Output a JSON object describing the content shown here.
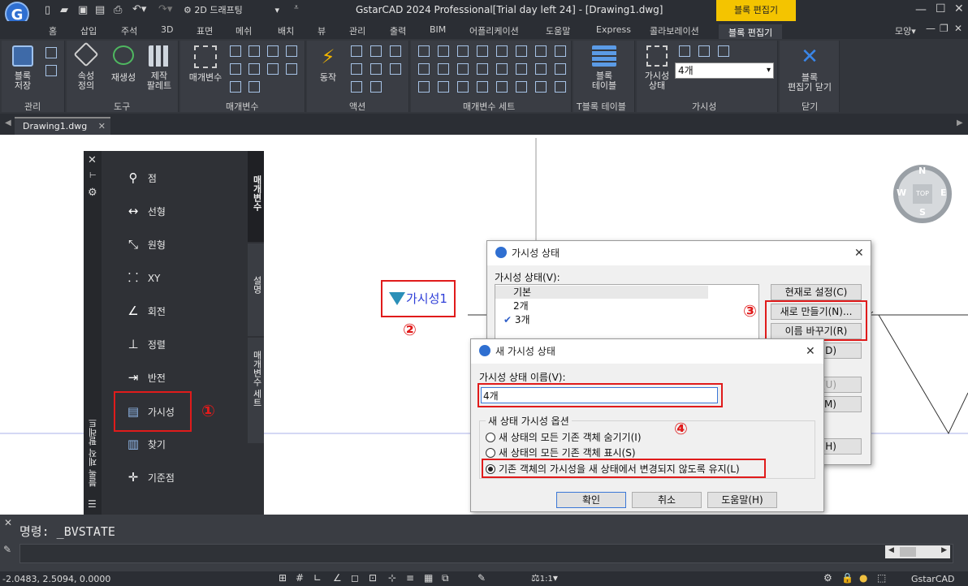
{
  "app": {
    "title": "GstarCAD 2024 Professional[Trial day left 24] - [Drawing1.dwg]",
    "workspace": "2D 드래프팅",
    "context_label": "블록 편집기"
  },
  "menu_tabs": [
    "홈",
    "삽입",
    "주석",
    "3D",
    "표면",
    "메쉬",
    "배치",
    "뷰",
    "관리",
    "출력",
    "BIM",
    "어플리케이션",
    "도움말",
    "Express",
    "콜라보레이션",
    "블록 편집기"
  ],
  "menu_right": "모양",
  "ribbon": {
    "groups": {
      "manage": "관리",
      "tools": "도구",
      "params": "매개변수",
      "actions": "액션",
      "param_sets": "매개변수 세트",
      "table": "T블록 테이블",
      "visibility": "가시성",
      "close": "닫기"
    },
    "buttons": {
      "block_save": "블록\n저장",
      "attr_def": "속성\n정의",
      "regen": "재생성",
      "authoring_palette": "제작\n팔레트",
      "param": "매개변수",
      "action": "동작",
      "block_table": "블록\n테이블",
      "vis_state": "가시성\n상태",
      "close_editor": "블록\n편집기 닫기"
    },
    "vis_combo": "4개"
  },
  "doc_tab": "Drawing1.dwg",
  "palette": {
    "items": [
      "점",
      "선형",
      "원형",
      "XY",
      "회전",
      "정렬",
      "반전",
      "가시성",
      "찾기",
      "기준점"
    ],
    "side_tabs": [
      "매개변수",
      "설명",
      "매개변수 세트"
    ],
    "title": "블록 제작 팔레트"
  },
  "canvas": {
    "param_label": "가시성1",
    "viewcube": {
      "top": "TOP",
      "n": "N",
      "s": "S",
      "e": "E",
      "w": "W"
    }
  },
  "markers": [
    "①",
    "②",
    "③",
    "④"
  ],
  "vis_dialog": {
    "title": "가시성 상태",
    "list_label": "가시성 상태(V):",
    "states": [
      "기본",
      "2개",
      "3개"
    ],
    "checked": "3개",
    "buttons": [
      "현재로 설정(C)",
      "새로 만들기(N)...",
      "이름 바꾸기(R)",
      "D)",
      "동(U)",
      "동(M)",
      "말(H)"
    ]
  },
  "new_dialog": {
    "title": "새 가시성 상태",
    "name_label": "가시성 상태 이름(V):",
    "name_value": "4개",
    "options_label": "새 상태 가시성 옵션",
    "options": [
      "새 상태의 모든 기존 객체 숨기기(I)",
      "새 상태의 모든 기존 객체 표시(S)",
      "기존 객체의 가시성을 새 상태에서 변경되지 않도록 유지(L)"
    ],
    "selected": 2,
    "buttons": [
      "확인",
      "취소",
      "도움말(H)"
    ]
  },
  "command": {
    "prompt": "명령:",
    "text": "_BVSTATE"
  },
  "status": {
    "coords": "-2.0483, 2.5094, 0.0000",
    "scale": "1:1",
    "brand": "GstarCAD"
  },
  "colors": {
    "accent": "#e01b1b",
    "chrome": "#2b2e34",
    "ribbon": "#33363c",
    "link": "#2f6fd1"
  }
}
